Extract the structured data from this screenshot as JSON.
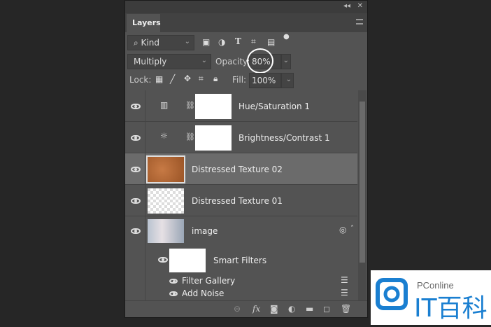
{
  "panel": {
    "title": "Layers",
    "collapse_icon": "double-chevron-icon",
    "close_icon": "close-icon"
  },
  "filter": {
    "kind_label": "Kind"
  },
  "blend": {
    "mode": "Multiply",
    "opacity_label": "Opacity:",
    "opacity_value": "80%"
  },
  "lock": {
    "label": "Lock:",
    "fill_label": "Fill:",
    "fill_value": "100%"
  },
  "layers": [
    {
      "name": "Hue/Saturation 1",
      "type": "adjustment"
    },
    {
      "name": "Brightness/Contrast 1",
      "type": "adjustment"
    },
    {
      "name": "Distressed Texture 02",
      "type": "pixel",
      "selected": true
    },
    {
      "name": "Distressed Texture 01",
      "type": "pixel"
    },
    {
      "name": "image",
      "type": "smart-object"
    }
  ],
  "smart_filters": {
    "label": "Smart Filters",
    "items": [
      "Filter Gallery",
      "Add Noise"
    ]
  },
  "watermark": {
    "brand": "PConline",
    "text": "IT百科"
  }
}
